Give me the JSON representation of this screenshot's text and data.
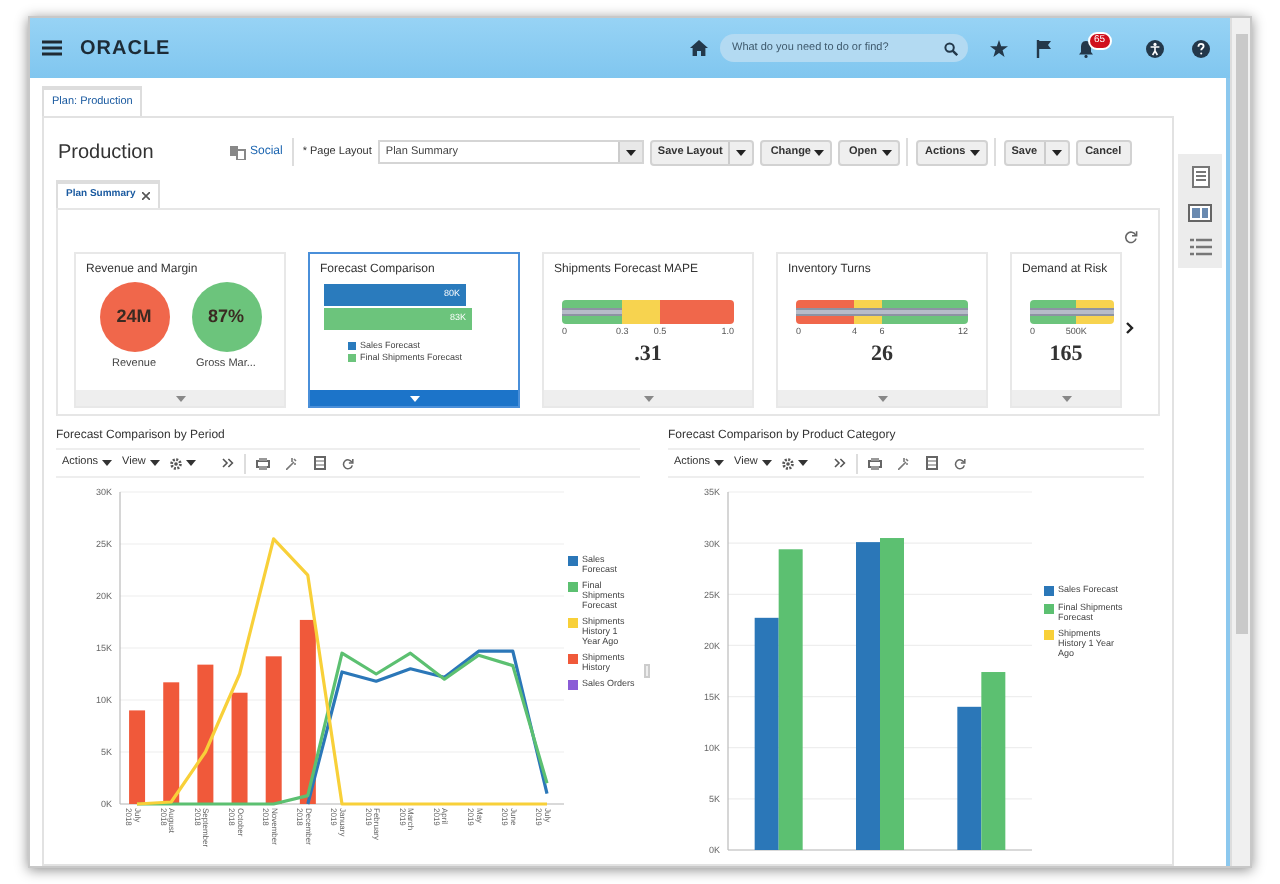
{
  "header": {
    "logo": "ORACLE",
    "search_placeholder": "What do you need to do or find?",
    "notification_count": "65"
  },
  "page_tabs": [
    {
      "label": "Plan: Production",
      "selected": true
    }
  ],
  "page": {
    "title": "Production",
    "social_link": "Social",
    "layout_label": "* Page Layout",
    "layout_value": "Plan Summary",
    "buttons": [
      {
        "label": "Save Layout",
        "kind": "split"
      },
      {
        "label": "Change",
        "kind": "menu"
      },
      {
        "label": "Open",
        "kind": "menu"
      },
      {
        "label": "Actions",
        "kind": "menu"
      },
      {
        "label": "Save",
        "kind": "split"
      },
      {
        "label": "Cancel",
        "kind": "plain"
      }
    ]
  },
  "summary_tabs": [
    {
      "label": "Plan Summary",
      "selected": true
    }
  ],
  "tiles": [
    {
      "kind": "circles",
      "title": "Revenue and Margin",
      "selected": false,
      "metrics": [
        {
          "value": "24M",
          "label": "Revenue",
          "color": "#f0674b"
        },
        {
          "value": "87%",
          "label": "Gross Mar...",
          "color": "#6cc47c"
        }
      ]
    },
    {
      "kind": "bars",
      "title": "Forecast Comparison",
      "selected": true,
      "bars": [
        {
          "value": "80K",
          "color": "#2a7bbd"
        },
        {
          "value": "83K",
          "color": "#6cc47c"
        }
      ],
      "legend": [
        {
          "label": "Sales Forecast",
          "color": "#2a7bbd"
        },
        {
          "label": "Final Shipments Forecast",
          "color": "#6cc47c"
        }
      ]
    },
    {
      "kind": "gauge",
      "title": "Shipments Forecast MAPE",
      "selected": false,
      "bands": [
        {
          "color": "#6cc47c"
        },
        {
          "color": "#f7d34f"
        },
        {
          "color": "#f0674b"
        }
      ],
      "ticks": [
        "0",
        "0.3",
        "0.5",
        "1.0"
      ],
      "value": ".31"
    },
    {
      "kind": "gauge",
      "title": "Inventory Turns",
      "selected": false,
      "bands": [
        {
          "color": "#f0674b"
        },
        {
          "color": "#f7d34f"
        },
        {
          "color": "#6cc47c"
        }
      ],
      "ticks": [
        "0",
        "4",
        "6",
        "12"
      ],
      "value": "26"
    },
    {
      "kind": "gauge",
      "title": "Demand at Risk",
      "selected": false,
      "bands": [
        {
          "color": "#6cc47c"
        },
        {
          "color": "#f7d34f"
        }
      ],
      "ticks": [
        "0",
        "500K"
      ],
      "value": "165"
    }
  ],
  "charts": [
    {
      "title": "Forecast Comparison by Period",
      "menus": [
        "Actions",
        "View"
      ],
      "chart_data": {
        "type": "line",
        "grid": true,
        "categories": [
          "July 2018",
          "August 2018",
          "September 2018",
          "October 2018",
          "November 2018",
          "December 2018",
          "January 2019",
          "February 2019",
          "March 2019",
          "April 2019",
          "May 2019",
          "June 2019",
          "July 2019"
        ],
        "ylim": [
          0,
          30000
        ],
        "yticks": [
          {
            "value": 0,
            "label": "0K"
          },
          {
            "value": 5000,
            "label": "5K"
          },
          {
            "value": 10000,
            "label": "10K"
          },
          {
            "value": 15000,
            "label": "15K"
          },
          {
            "value": 20000,
            "label": "20K"
          },
          {
            "value": 25000,
            "label": "25K"
          },
          {
            "value": 30000,
            "label": "30K"
          }
        ],
        "series": [
          {
            "name": "Sales Forecast",
            "color": "#2b77b8",
            "values": [
              null,
              null,
              null,
              null,
              null,
              0,
              12700,
              11800,
              13000,
              12200,
              14700,
              14700,
              1000
            ]
          },
          {
            "name": "Final Shipments Forecast",
            "color": "#5cc071",
            "values": [
              0,
              0,
              0,
              0,
              0,
              800,
              14500,
              12500,
              14500,
              12000,
              14300,
              13300,
              2000
            ]
          },
          {
            "name": "Shipments History 1 Year Ago",
            "color": "#f8d039",
            "values": [
              0,
              200,
              5000,
              12500,
              25500,
              22000,
              0,
              0,
              0,
              0,
              0,
              0,
              0
            ]
          },
          {
            "name": "Shipments History",
            "color": "#f0593a",
            "type": "bar",
            "values": [
              9000,
              11700,
              13400,
              10700,
              14200,
              17700,
              null,
              null,
              null,
              null,
              null,
              null,
              null
            ]
          },
          {
            "name": "Sales Orders",
            "color": "#8a5cd6",
            "values": [
              null,
              null,
              null,
              null,
              null,
              null,
              null,
              null,
              null,
              null,
              null,
              null,
              null
            ]
          }
        ]
      }
    },
    {
      "title": "Forecast Comparison by Product Category",
      "menus": [
        "Actions",
        "View"
      ],
      "chart_data": {
        "type": "bar",
        "grid": true,
        "ylim": [
          0,
          35000
        ],
        "yticks": [
          {
            "value": 0,
            "label": "0K"
          },
          {
            "value": 5000,
            "label": "5K"
          },
          {
            "value": 10000,
            "label": "10K"
          },
          {
            "value": 15000,
            "label": "15K"
          },
          {
            "value": 20000,
            "label": "20K"
          },
          {
            "value": 25000,
            "label": "25K"
          },
          {
            "value": 30000,
            "label": "30K"
          },
          {
            "value": 35000,
            "label": "35K"
          }
        ],
        "series": [
          {
            "name": "Sales Forecast",
            "color": "#2b77b8",
            "values": [
              22700,
              30100,
              14000
            ]
          },
          {
            "name": "Final Shipments Forecast",
            "color": "#5cc071",
            "values": [
              29400,
              30500,
              17400
            ]
          },
          {
            "name": "Shipments History 1 Year Ago",
            "color": "#f8d039",
            "values": [
              null,
              null,
              null
            ]
          }
        ]
      }
    }
  ]
}
